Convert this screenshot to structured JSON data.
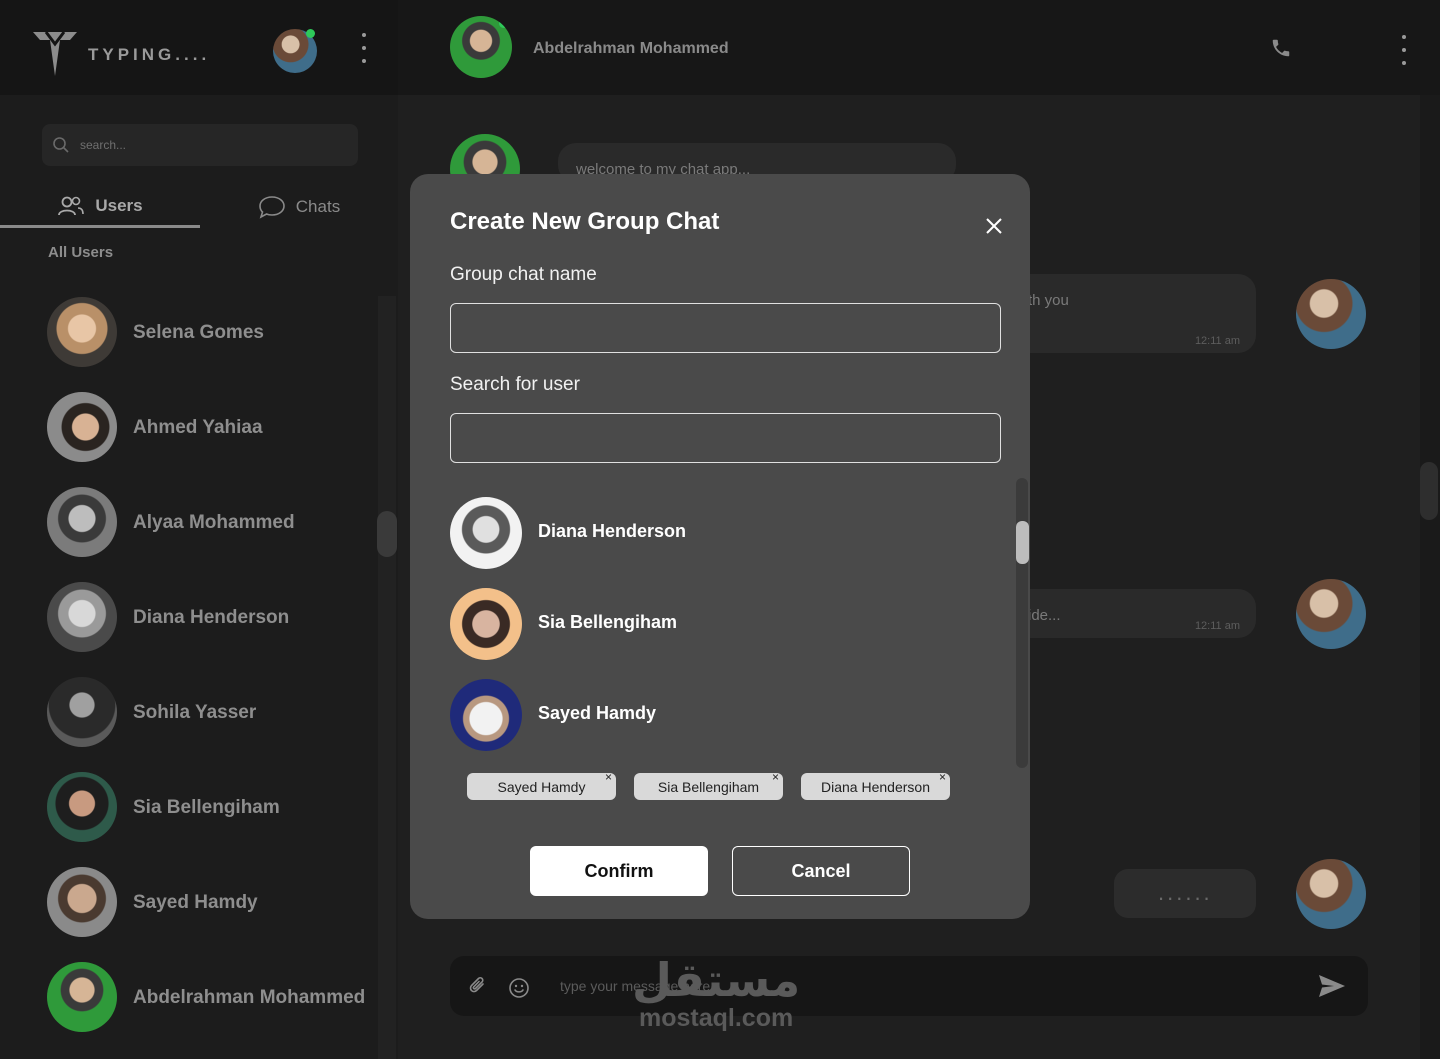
{
  "app": {
    "brand": "TYPING...."
  },
  "sidebar": {
    "search_placeholder": "search...",
    "tabs": [
      {
        "label": "Users"
      },
      {
        "label": "Chats"
      }
    ],
    "section_label": "All Users",
    "users": [
      {
        "name": "Selena Gomes"
      },
      {
        "name": "Ahmed Yahiaa"
      },
      {
        "name": "Alyaa Mohammed"
      },
      {
        "name": "Diana Henderson"
      },
      {
        "name": "Sohila Yasser"
      },
      {
        "name": "Sia Bellengiham"
      },
      {
        "name": "Sayed Hamdy"
      },
      {
        "name": "Abdelrahman Mohammed"
      }
    ]
  },
  "chat": {
    "contact_name": "Abdelrahman Mohammed",
    "messages": [
      {
        "text": "welcome to my chat app..."
      },
      {
        "text": "th you",
        "time": "12:11 am"
      },
      {
        "text": "ide...",
        "time": "12:11 am"
      },
      {
        "text": "......"
      }
    ],
    "composer_placeholder": "type your message here"
  },
  "modal": {
    "title": "Create New Group Chat",
    "group_name_label": "Group chat name",
    "group_name_value": "",
    "search_label": "Search for user",
    "search_value": "",
    "results": [
      {
        "name": "Diana Henderson"
      },
      {
        "name": "Sia Bellengiham"
      },
      {
        "name": "Sayed Hamdy"
      }
    ],
    "selected": [
      {
        "name": "Sayed Hamdy"
      },
      {
        "name": "Sia Bellengiham"
      },
      {
        "name": "Diana Henderson"
      }
    ],
    "chip_remove": "×",
    "confirm_label": "Confirm",
    "cancel_label": "Cancel"
  },
  "watermark": {
    "arabic": "مستقل",
    "latin": "mostaql.com"
  },
  "colors": {
    "modal_bg": "#4a4a4a",
    "online": "#2ec95a",
    "app_bg": "#1a1a1a"
  }
}
